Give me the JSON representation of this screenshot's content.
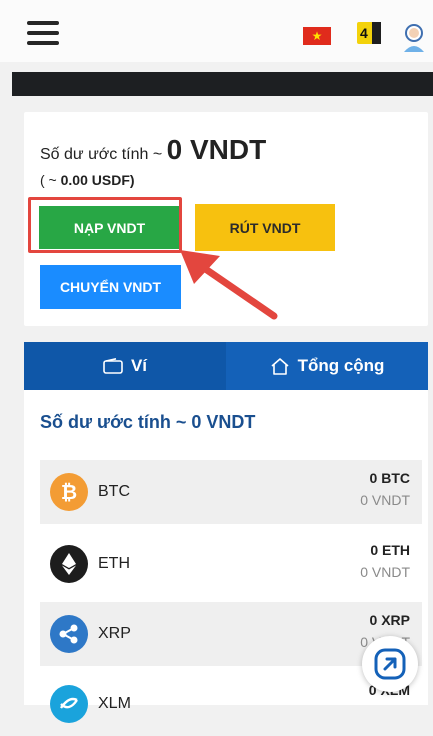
{
  "header": {
    "language_flag": "vietnam-flag-icon",
    "notice_badge": "4"
  },
  "balance": {
    "label": "Số dư ước tính ~",
    "amount": "0 VNDT",
    "usd_prefix": "( ~ ",
    "usd_value": "0.00 USDF",
    "usd_suffix": ")"
  },
  "actions": {
    "deposit": "NẠP VNDT",
    "withdraw": "RÚT VNDT",
    "transfer": "CHUYỂN VNDT"
  },
  "tabs": [
    {
      "label": "Ví",
      "icon": "wallet-icon"
    },
    {
      "label": "Tổng cộng",
      "icon": "home-icon"
    }
  ],
  "wallet": {
    "title": "Số dư ước tính ~ 0 VNDT",
    "coins": [
      {
        "symbol": "BTC",
        "amount": "0 BTC",
        "value": "0 VNDT",
        "icon": "bitcoin-icon",
        "color": "#f39c34"
      },
      {
        "symbol": "ETH",
        "amount": "0 ETH",
        "value": "0 VNDT",
        "icon": "ethereum-icon",
        "color": "#1d1d1d"
      },
      {
        "symbol": "XRP",
        "amount": "0 XRP",
        "value": "0 VNDT",
        "icon": "ripple-icon",
        "color": "#2e78c7"
      },
      {
        "symbol": "XLM",
        "amount": "0 XLM",
        "value": "",
        "icon": "stellar-icon",
        "color": "#1aa3dc"
      }
    ]
  },
  "colors": {
    "deposit": "#28a745",
    "withdraw": "#f7c10f",
    "transfer": "#1a8cff",
    "tab_bar": "#1461b8",
    "highlight": "#e3463e"
  }
}
